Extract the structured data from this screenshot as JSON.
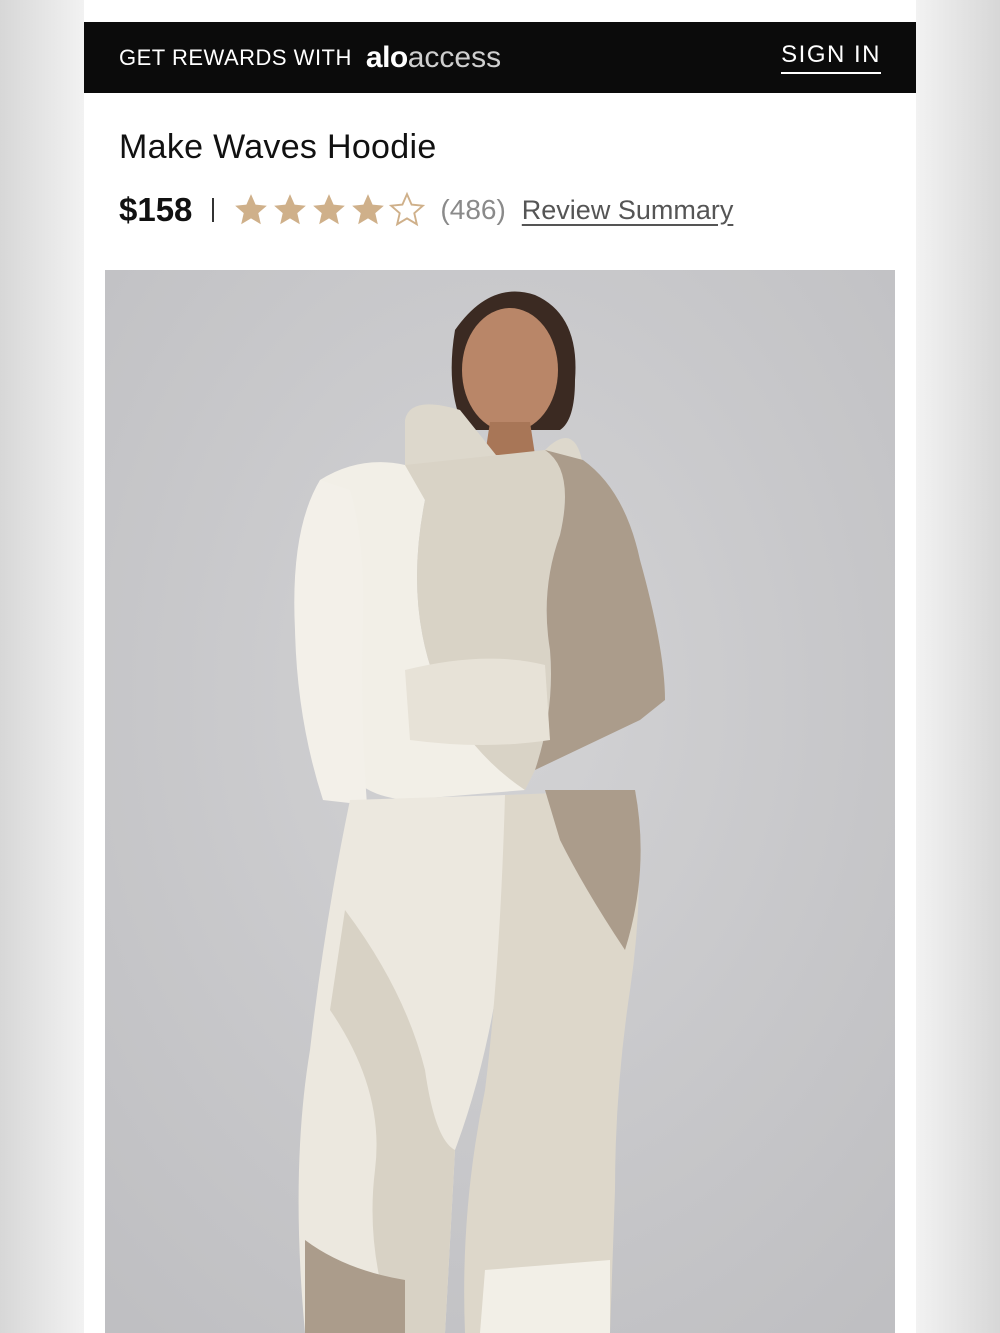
{
  "rewards_bar": {
    "text": "GET REWARDS WITH",
    "logo_bold": "alo",
    "logo_light": "access",
    "sign_in": "SIGN IN"
  },
  "product": {
    "title": "Make Waves Hoodie",
    "price": "$158",
    "rating": 4,
    "rating_max": 5,
    "review_count": "(486)",
    "review_link": "Review Summary"
  },
  "colors": {
    "star_filled": "#cfb08a",
    "star_empty": "#cfb08a",
    "bar_bg": "#0b0b0b",
    "hero_bg": "#c9c9cb"
  },
  "hero_image": {
    "subject": "model wearing colorblock hoodie and sweatpants"
  }
}
